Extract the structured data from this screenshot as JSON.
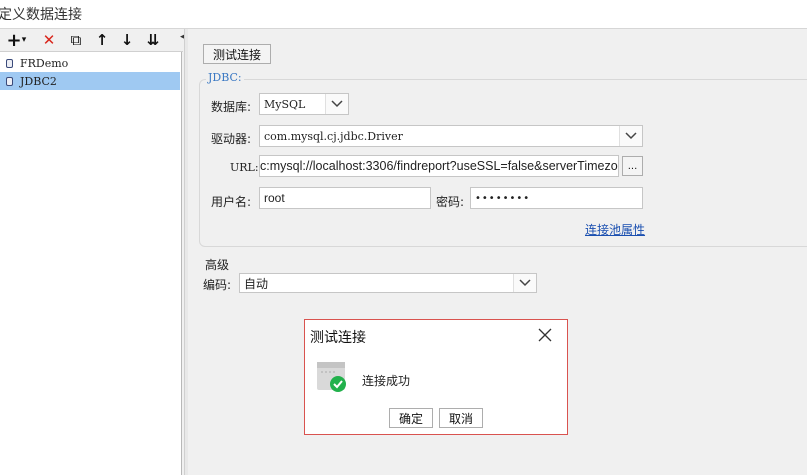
{
  "window": {
    "title": "定义数据连接"
  },
  "toolbar": {
    "add": "+",
    "add_dropdown": "▾",
    "delete": "✕",
    "copy": "⧉",
    "move_up": "↑",
    "move_down": "↓",
    "sort": "⇊",
    "collapse": "◀"
  },
  "connections": [
    {
      "name": "FRDemo",
      "selected": false
    },
    {
      "name": "JDBC2",
      "selected": true
    }
  ],
  "test_button": "测试连接",
  "jdbc": {
    "legend": "JDBC:",
    "database_label": "数据库:",
    "database_value": "MySQL",
    "driver_label": "驱动器:",
    "driver_value": "com.mysql.cj.jdbc.Driver",
    "url_label": "URL:",
    "url_value": "c:mysql://localhost:3306/findreport?useSSL=false&serverTimezo",
    "url_more": "...",
    "username_label": "用户名:",
    "username_value": "root",
    "password_label": "密码:",
    "password_value": "••••••••",
    "pool_link": "连接池属性"
  },
  "advanced": {
    "heading": "高级",
    "encoding_label": "编码:",
    "encoding_value": "自动"
  },
  "dialog": {
    "title": "测试连接",
    "message": "连接成功",
    "ok": "确定",
    "cancel": "取消",
    "icon": "success-check-icon"
  },
  "colors": {
    "selection": "#9fc9f2",
    "link": "#1a4fb0",
    "dialog_border": "#d9534f",
    "success": "#22b14c"
  }
}
